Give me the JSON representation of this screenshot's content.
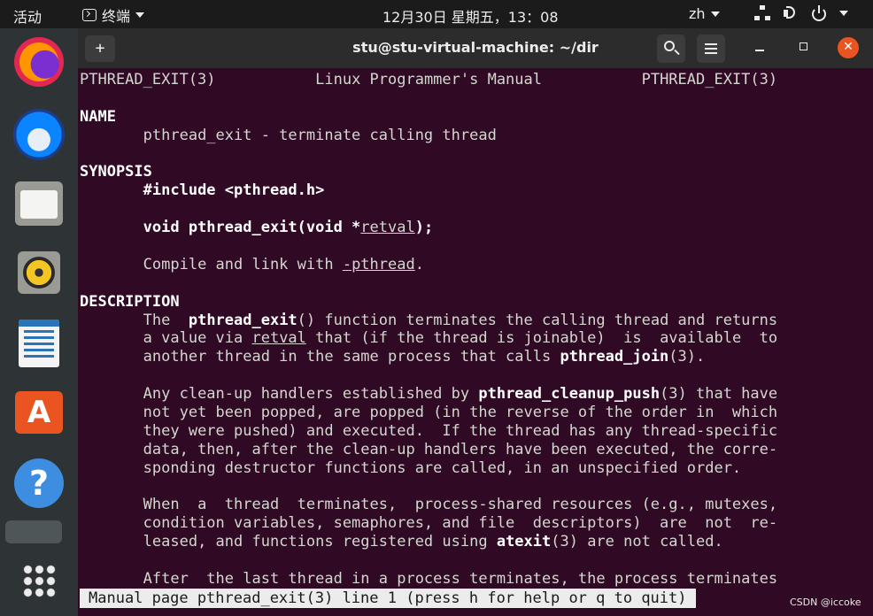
{
  "topbar": {
    "activities": "活动",
    "app_menu": "终端",
    "clock": "12月30日 星期五，13：08",
    "lang": "zh"
  },
  "dock": {
    "items": [
      "firefox",
      "thunderbird",
      "files",
      "rhythmbox",
      "libreoffice-writer",
      "software",
      "help",
      "show-applications"
    ]
  },
  "window": {
    "title": "stu@stu-virtual-machine: ~/dir",
    "close_glyph": "✕",
    "newtab_glyph": "+"
  },
  "man": {
    "header_left": "PTHREAD_EXIT(3)",
    "header_center": "Linux Programmer's Manual",
    "header_right": "PTHREAD_EXIT(3)",
    "name_heading": "NAME",
    "name_text": "pthread_exit - terminate calling thread",
    "synopsis_heading": "SYNOPSIS",
    "include": "#include <pthread.h>",
    "proto_bold": "void pthread_exit(void *",
    "proto_arg": "retval",
    "proto_end": ");",
    "compile_pre": "Compile and link with ",
    "compile_flag": "-pthread",
    "compile_end": ".",
    "description_heading": "DESCRIPTION",
    "d1_a": "The  ",
    "d1_fn": "pthread_exit",
    "d1_b": "() function terminates the calling thread and returns",
    "d2_a": "a value via ",
    "d2_arg": "retval",
    "d2_b": " that (if the thread is joinable)  is  available  to",
    "d3_a": "another thread in the same process that calls ",
    "d3_fn": "pthread_join",
    "d3_b": "(3).",
    "p2_1a": "Any clean-up handlers established by ",
    "p2_1fn": "pthread_cleanup_push",
    "p2_1b": "(3) that have",
    "p2_2": "not yet been popped, are popped (in the reverse of the order in  which",
    "p2_3": "they were pushed) and executed.  If the thread has any thread-specific",
    "p2_4": "data, then, after the clean-up handlers have been executed, the corre‐",
    "p2_5": "sponding destructor functions are called, in an unspecified order.",
    "p3_1": "When  a  thread  terminates,  process-shared resources (e.g., mutexes,",
    "p3_2": "condition variables, semaphores, and file  descriptors)  are  not  re‐",
    "p3_3a": "leased, and functions registered using ",
    "p3_3fn": "atexit",
    "p3_3b": "(3) are not called.",
    "p4_1": "After  the last thread in a process terminates, the process terminates"
  },
  "status_line": "Manual page pthread_exit(3) line 1 (press h for help or q to quit)",
  "watermark": "CSDN @iccoke"
}
